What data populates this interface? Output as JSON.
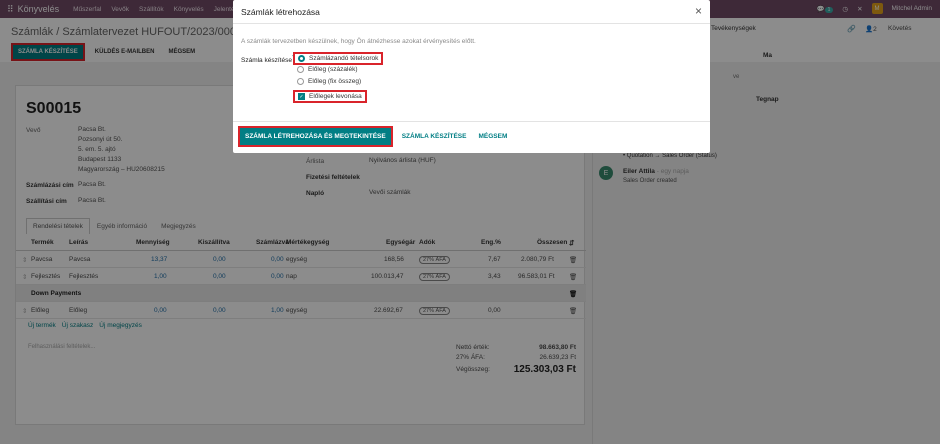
{
  "topbar": {
    "app_name": "Könyvelés",
    "menu": [
      "Műszerfal",
      "Vevők",
      "Szállítók",
      "Könyvelés",
      "Jelentés"
    ],
    "user": "Mitchel Admin",
    "user_initial": "M",
    "badge": "1"
  },
  "control_panel": {
    "breadcrumb": "Számlák / Számlatervezet HUFOUT/2023/00024 / S00015",
    "btn_create_invoice": "SZÁMLA KÉSZÍTÉSE",
    "btn_send_email": "KÜLDÉS E-MAILBEN",
    "btn_cancel": "MÉGSEM"
  },
  "chatter_header": {
    "activities": "Tevékenységek",
    "followers_count": "2",
    "follow": "Követés"
  },
  "order": {
    "name": "S00015",
    "customer_label": "Vevő",
    "customer_lines": [
      "Pacsa Bt.",
      "Pozsonyi út 50.",
      "5. em. 5. ajtó",
      "Budapest 1133",
      "Magyarország – HU20608215"
    ],
    "invoice_address_label": "Számlázási cím",
    "invoice_address": "Pacsa Bt.",
    "delivery_address_label": "Szállítási cím",
    "delivery_address": "Pacsa Bt.",
    "pricelist_label": "Árlista",
    "pricelist": "Nyilvános árlista (HUF)",
    "payment_terms_label": "Fizetési feltételek",
    "journal_label": "Napló",
    "journal": "Vevői számlák"
  },
  "tabs": [
    "Rendelési tételek",
    "Egyéb információ",
    "Megjegyzés"
  ],
  "table": {
    "headers": [
      "Termék",
      "Leírás",
      "Mennyiség",
      "Kiszállítva",
      "Számlázva",
      "Mértékegység",
      "Egységár",
      "Adók",
      "Eng.%",
      "Összesen"
    ],
    "rows": [
      {
        "product": "Pavcsa",
        "desc": "Pavcsa",
        "qty": "13,37",
        "delivered": "0,00",
        "invoiced": "0,00",
        "uom": "egység",
        "price": "168,56",
        "tax": "27% ÁFA",
        "disc": "7,67",
        "total": "2.080,79 Ft"
      },
      {
        "product": "Fejlesztés",
        "desc": "Fejlesztés",
        "qty": "1,00",
        "delivered": "0,00",
        "invoiced": "0,00",
        "uom": "nap",
        "price": "100.013,47",
        "tax": "27% ÁFA",
        "disc": "3,43",
        "total": "96.583,01 Ft"
      }
    ],
    "section": "Down Payments",
    "dp_row": {
      "product": "Előleg",
      "desc": "Előleg",
      "qty": "0,00",
      "delivered": "0,00",
      "invoiced": "1,00",
      "uom": "egység",
      "price": "22.692,67",
      "tax": "27% ÁFA",
      "disc": "0,00"
    },
    "add_product": "Új termék",
    "add_section": "Új szakasz",
    "add_note": "Új megjegyzés"
  },
  "terms_placeholder": "Felhasználási feltételek...",
  "totals": {
    "net_label": "Nettó érték:",
    "net": "98.663,80 Ft",
    "tax_label": "27% ÁFA:",
    "tax": "26.639,23 Ft",
    "total_label": "Végösszeg:",
    "total": "125.303,03 Ft"
  },
  "chatter": {
    "day_label_ma": "Ma",
    "day_label_tegnap": "Tegnap",
    "partial_text": "ve",
    "tracking": "Quotation → Sales Order (Status)",
    "author": "Eiler Attila",
    "author_time": "- egy napja",
    "author_initial": "E",
    "message": "Sales Order created"
  },
  "modal": {
    "title": "Számlák létrehozása",
    "close": "×",
    "description": "A számlák tervezetben készülnek, hogy Ön átnézhesse azokat érvényesítés előtt.",
    "field_label": "Számla készítése",
    "field_sup": "?",
    "options": [
      "Számlázandó tételsorok",
      "Előleg (százalék)",
      "Előleg (fix összeg)"
    ],
    "checkbox_label": "Előlegek levonása",
    "btn_create_view": "SZÁMLA LÉTREHOZÁSA ÉS MEGTEKINTÉSE",
    "btn_create": "SZÁMLA KÉSZÍTÉSE",
    "btn_cancel": "MÉGSEM"
  }
}
